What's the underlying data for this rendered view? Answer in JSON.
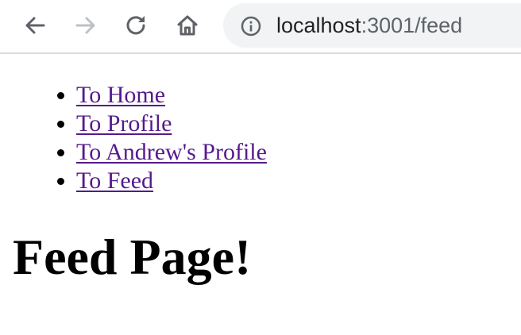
{
  "browser": {
    "url_host": "localhost",
    "url_rest": ":3001/feed",
    "icons": {
      "back": "back-arrow-icon",
      "forward": "forward-arrow-icon",
      "reload": "reload-icon",
      "home": "home-icon",
      "site_info": "info-icon"
    },
    "colors": {
      "icon_active": "#5f6368",
      "icon_disabled": "#bdc1c6",
      "omnibox_bg": "#f1f3f4",
      "visited_link": "#551a8b"
    }
  },
  "page": {
    "nav_links": [
      {
        "label": "To Home"
      },
      {
        "label": "To Profile"
      },
      {
        "label": "To Andrew's Profile"
      },
      {
        "label": "To Feed"
      }
    ],
    "heading": "Feed Page!"
  }
}
